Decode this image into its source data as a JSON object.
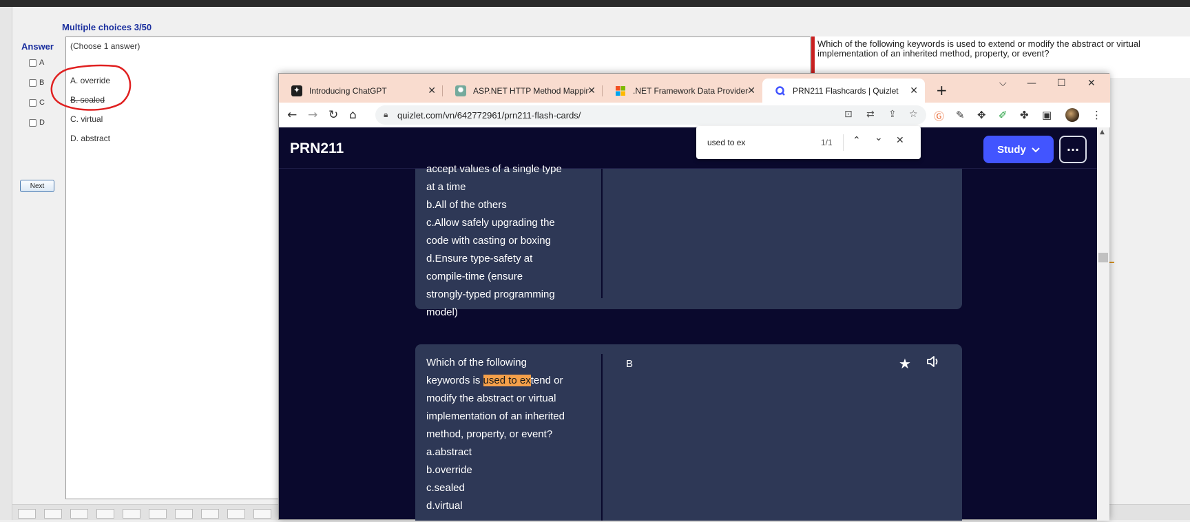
{
  "exam": {
    "title": "Multiple choices 3/50",
    "answer_label": "Answer",
    "answer_options": [
      "A",
      "B",
      "C",
      "D"
    ],
    "choose_hint": "(Choose 1 answer)",
    "choices": [
      "A.  override",
      "B.  sealed",
      "C.  virtual",
      "D.  abstract"
    ],
    "next_label": "Next",
    "question_text": "Which of the following keywords is used to extend or modify the abstract or virtual implementation of an inherited method, property, or event?"
  },
  "browser": {
    "tabs": [
      {
        "label": "Introducing ChatGPT",
        "icon": "chatgpt-icon"
      },
      {
        "label": "ASP.NET HTTP Method Mapping",
        "icon": "openai-icon"
      },
      {
        "label": ".NET Framework Data Providers",
        "icon": "microsoft-icon"
      },
      {
        "label": "PRN211 Flashcards | Quizlet",
        "icon": "quizlet-icon"
      }
    ],
    "url": "quizlet.com/vn/642772961/prn211-flash-cards/",
    "find": {
      "query": "used to ex",
      "count": "1/1"
    }
  },
  "quizlet": {
    "brand": "PRN211",
    "study_label": "Study",
    "card1_term": "accept values of a single type\nat a time\nb.All of the others\nc.Allow safely upgrading the\ncode with casting or boxing\nd.Ensure type-safety at\ncompile-time (ensure\nstrongly-typed programming\nmodel)",
    "card2": {
      "before": "Which of the following\nkeywords is ",
      "highlight": "used to ex",
      "after": "tend or\nmodify the abstract or virtual\nimplementation of an inherited\nmethod, property, or event?\na.abstract\nb.override\nc.sealed\nd.virtual",
      "definition": "B"
    }
  },
  "colors": {
    "quizlet_bg": "#0a092d",
    "card_bg": "#2e3856",
    "study_button": "#4255ff",
    "tab_strip": "#f9dccf",
    "highlight": "#f5a04a",
    "exam_title": "#1a2f9e",
    "annotation_red": "#e02020"
  }
}
